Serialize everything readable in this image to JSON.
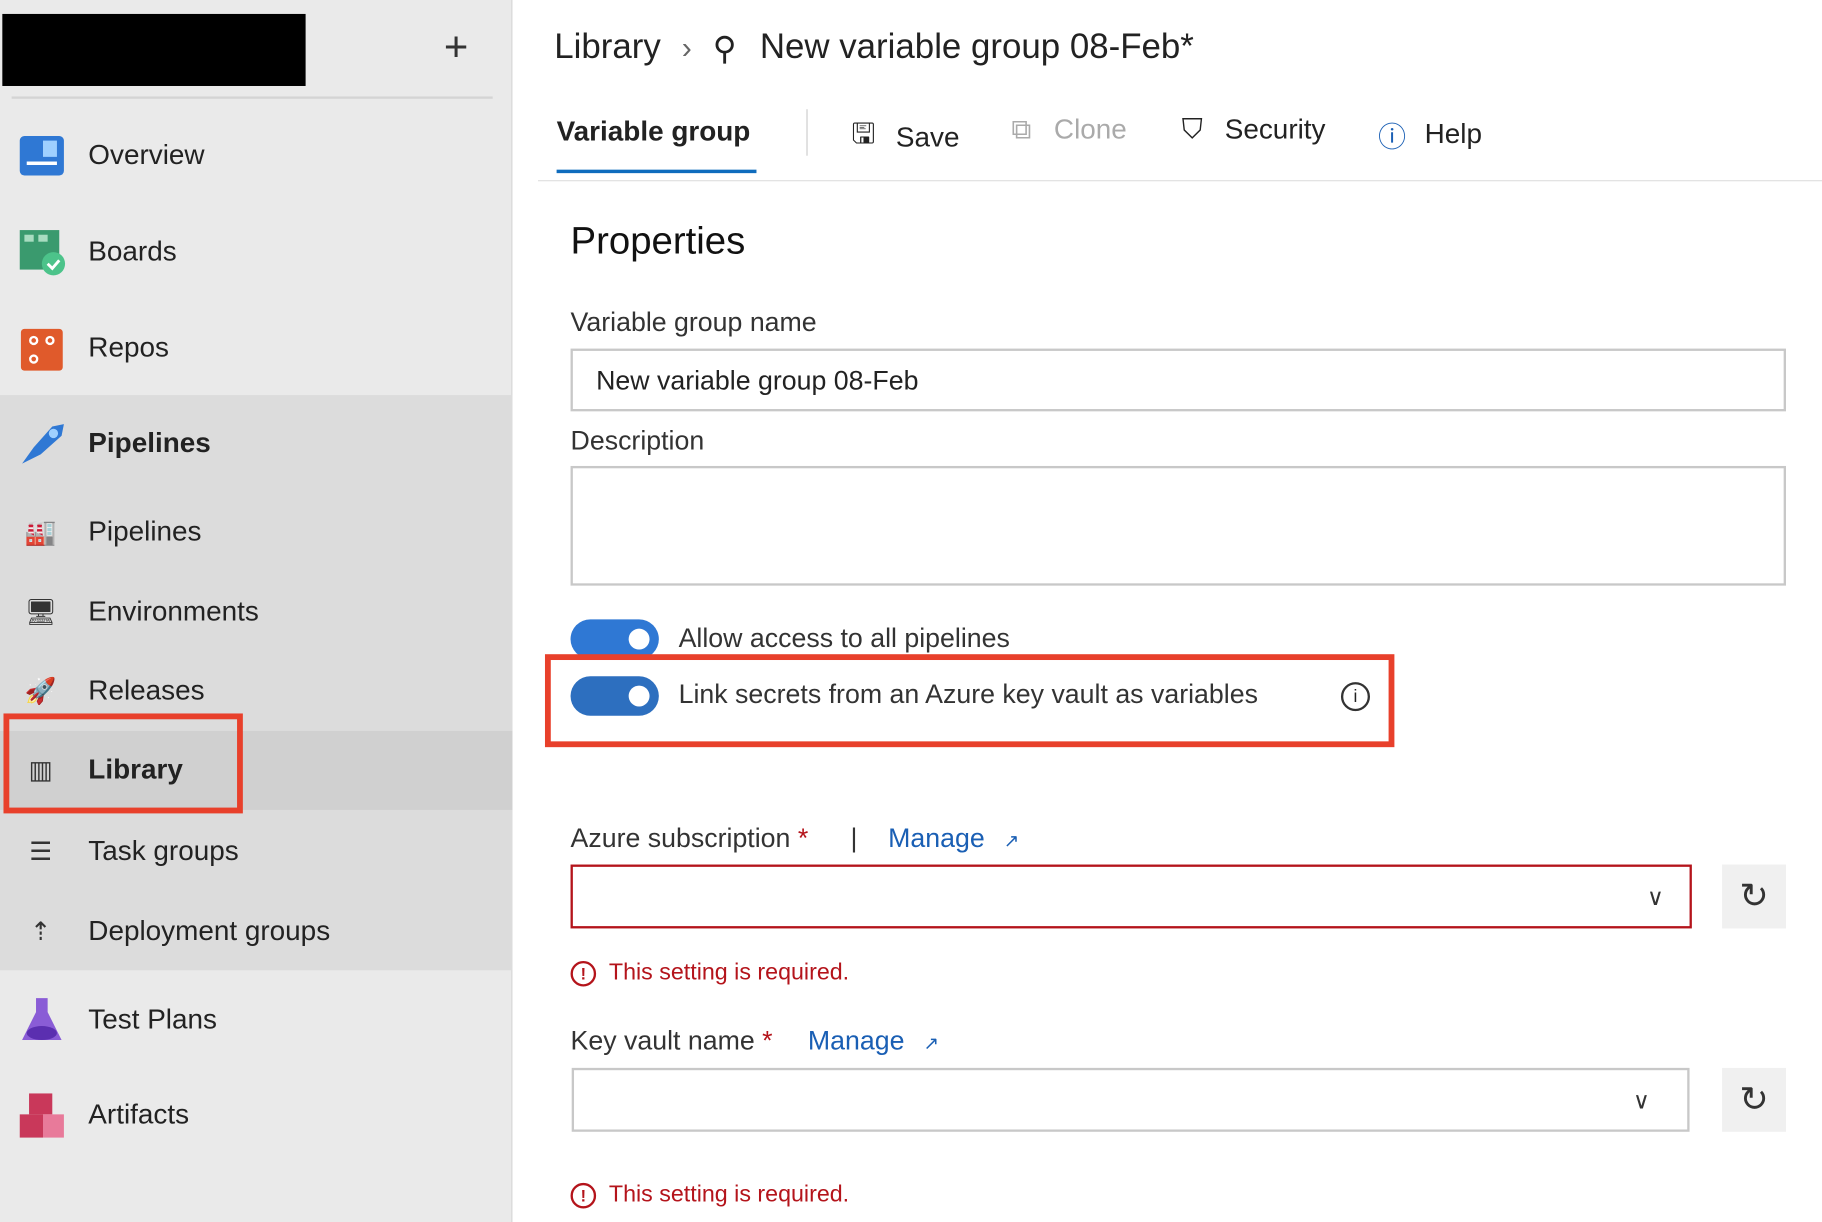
{
  "sidebar": {
    "add_label": "+",
    "items": [
      {
        "label": "Overview",
        "icon": "overview-icon"
      },
      {
        "label": "Boards",
        "icon": "boards-icon"
      },
      {
        "label": "Repos",
        "icon": "repos-icon"
      },
      {
        "label": "Pipelines",
        "icon": "pipelines-icon"
      },
      {
        "label": "Pipelines",
        "icon": "pipelines-sub-icon"
      },
      {
        "label": "Environments",
        "icon": "environments-icon"
      },
      {
        "label": "Releases",
        "icon": "releases-icon"
      },
      {
        "label": "Library",
        "icon": "library-icon",
        "selected": true
      },
      {
        "label": "Task groups",
        "icon": "task-groups-icon"
      },
      {
        "label": "Deployment groups",
        "icon": "deployment-groups-icon"
      },
      {
        "label": "Test Plans",
        "icon": "test-plans-icon"
      },
      {
        "label": "Artifacts",
        "icon": "artifacts-icon"
      }
    ]
  },
  "header": {
    "breadcrumb_root": "Library",
    "title": "New variable group 08-Feb*"
  },
  "toolbar": {
    "tab": "Variable group",
    "save": "Save",
    "clone": "Clone",
    "security": "Security",
    "help": "Help"
  },
  "form": {
    "section_title": "Properties",
    "name_label": "Variable group name",
    "name_value": "New variable group 08-Feb",
    "description_label": "Description",
    "description_value": "",
    "allow_access_label": "Allow access to all pipelines",
    "allow_access_on": true,
    "link_secrets_label": "Link secrets from an Azure key vault as variables",
    "link_secrets_on": true,
    "subscription_label": "Azure subscription",
    "required_mark": "*",
    "divider": "|",
    "manage_label": "Manage",
    "keyvault_label": "Key vault name",
    "error_text": "This setting is required."
  },
  "colors": {
    "accent": "#2f78d4",
    "highlight": "#e8402b",
    "error": "#b4141b",
    "link": "#1a5fb4"
  }
}
